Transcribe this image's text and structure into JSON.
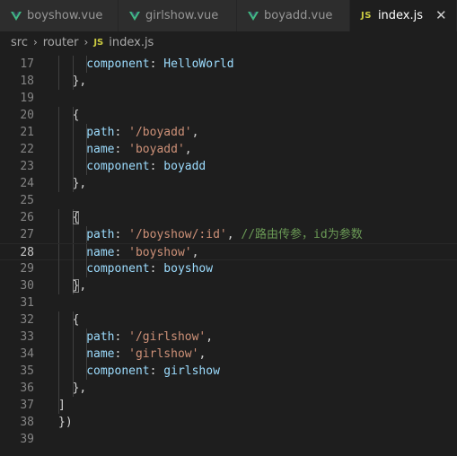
{
  "tabs": [
    {
      "label": "boyshow.vue",
      "icon": "vue-icon",
      "active": false
    },
    {
      "label": "girlshow.vue",
      "icon": "vue-icon",
      "active": false
    },
    {
      "label": "boyadd.vue",
      "icon": "vue-icon",
      "active": false
    },
    {
      "label": "index.js",
      "icon": "js-icon",
      "active": true,
      "icon_text": "JS",
      "close": "✕"
    }
  ],
  "breadcrumb": {
    "items": [
      "src",
      "router",
      "index.js"
    ],
    "separator": "›",
    "file_icon_text": "JS"
  },
  "colors": {
    "background": "#1e1e1e",
    "keyword": "#9cdcfe",
    "string": "#ce9178",
    "comment": "#6a9955",
    "punctuation": "#d4d4d4",
    "vue_green": "#41b883",
    "js_yellow": "#cbcb41"
  },
  "editor": {
    "current_line": 28,
    "lines": [
      {
        "n": "17",
        "tokens": [
          [
            "key",
            "component"
          ],
          [
            "punc",
            ": "
          ],
          [
            "id",
            "HelloWorld"
          ]
        ],
        "indent": 3
      },
      {
        "n": "18",
        "tokens": [
          [
            "punc",
            "},"
          ]
        ],
        "indent": 2
      },
      {
        "n": "19",
        "tokens": [],
        "indent": 0
      },
      {
        "n": "20",
        "tokens": [
          [
            "punc",
            "{"
          ]
        ],
        "indent": 2
      },
      {
        "n": "21",
        "tokens": [
          [
            "key",
            "path"
          ],
          [
            "punc",
            ": "
          ],
          [
            "str",
            "'/boyadd'"
          ],
          [
            "punc",
            ","
          ]
        ],
        "indent": 3
      },
      {
        "n": "22",
        "tokens": [
          [
            "key",
            "name"
          ],
          [
            "punc",
            ": "
          ],
          [
            "str",
            "'boyadd'"
          ],
          [
            "punc",
            ","
          ]
        ],
        "indent": 3
      },
      {
        "n": "23",
        "tokens": [
          [
            "key",
            "component"
          ],
          [
            "punc",
            ": "
          ],
          [
            "id",
            "boyadd"
          ]
        ],
        "indent": 3
      },
      {
        "n": "24",
        "tokens": [
          [
            "punc",
            "},"
          ]
        ],
        "indent": 2
      },
      {
        "n": "25",
        "tokens": [],
        "indent": 0
      },
      {
        "n": "26",
        "tokens": [
          [
            "punc",
            "{"
          ]
        ],
        "indent": 2
      },
      {
        "n": "27",
        "tokens": [
          [
            "key",
            "path"
          ],
          [
            "punc",
            ": "
          ],
          [
            "str",
            "'/boyshow/:id'"
          ],
          [
            "punc",
            ", "
          ],
          [
            "cmt",
            "//路由传参，id为参数"
          ]
        ],
        "indent": 3
      },
      {
        "n": "28",
        "tokens": [
          [
            "key",
            "name"
          ],
          [
            "punc",
            ": "
          ],
          [
            "str",
            "'boyshow'"
          ],
          [
            "punc",
            ","
          ]
        ],
        "indent": 3
      },
      {
        "n": "29",
        "tokens": [
          [
            "key",
            "component"
          ],
          [
            "punc",
            ": "
          ],
          [
            "id",
            "boyshow"
          ]
        ],
        "indent": 3
      },
      {
        "n": "30",
        "tokens": [
          [
            "punc",
            "},"
          ]
        ],
        "indent": 2
      },
      {
        "n": "31",
        "tokens": [],
        "indent": 0
      },
      {
        "n": "32",
        "tokens": [
          [
            "punc",
            "{"
          ]
        ],
        "indent": 2
      },
      {
        "n": "33",
        "tokens": [
          [
            "key",
            "path"
          ],
          [
            "punc",
            ": "
          ],
          [
            "str",
            "'/girlshow'"
          ],
          [
            "punc",
            ","
          ]
        ],
        "indent": 3
      },
      {
        "n": "34",
        "tokens": [
          [
            "key",
            "name"
          ],
          [
            "punc",
            ": "
          ],
          [
            "str",
            "'girlshow'"
          ],
          [
            "punc",
            ","
          ]
        ],
        "indent": 3
      },
      {
        "n": "35",
        "tokens": [
          [
            "key",
            "component"
          ],
          [
            "punc",
            ": "
          ],
          [
            "id",
            "girlshow"
          ]
        ],
        "indent": 3
      },
      {
        "n": "36",
        "tokens": [
          [
            "punc",
            "},"
          ]
        ],
        "indent": 2
      },
      {
        "n": "37",
        "tokens": [
          [
            "punc",
            "]"
          ]
        ],
        "indent": 1
      },
      {
        "n": "38",
        "tokens": [
          [
            "punc",
            "})"
          ]
        ],
        "indent": 0
      },
      {
        "n": "39",
        "tokens": [],
        "indent": 0
      }
    ]
  }
}
